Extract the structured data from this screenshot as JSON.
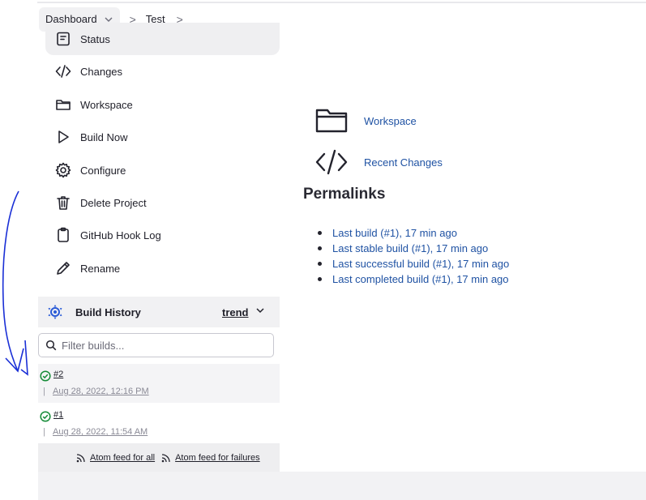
{
  "breadcrumb": {
    "dashboard": "Dashboard",
    "separator": ">",
    "job": "Test"
  },
  "side_tasks": [
    {
      "label": "Status",
      "icon": "status-icon"
    },
    {
      "label": "Changes",
      "icon": "code-icon"
    },
    {
      "label": "Workspace",
      "icon": "folder-icon"
    },
    {
      "label": "Build Now",
      "icon": "play-icon"
    },
    {
      "label": "Configure",
      "icon": "gear-icon"
    },
    {
      "label": "Delete Project",
      "icon": "trash-icon"
    },
    {
      "label": "GitHub Hook Log",
      "icon": "clipboard-icon"
    },
    {
      "label": "Rename",
      "icon": "pencil-icon"
    }
  ],
  "build_history": {
    "title": "Build History",
    "trend": "trend",
    "filter_placeholder": "Filter builds...",
    "builds": [
      {
        "number": "#2",
        "date": "Aug 28, 2022, 12:16 PM",
        "status": "success"
      },
      {
        "number": "#1",
        "date": "Aug 28, 2022, 11:54 AM",
        "status": "success"
      }
    ],
    "feed_all": "Atom feed for all",
    "feed_failures": "Atom feed for failures"
  },
  "main": {
    "workspace_link": "Workspace",
    "recent_changes_link": "Recent Changes",
    "permalinks_title": "Permalinks",
    "permalinks": [
      "Last build (#1), 17 min ago",
      "Last stable build (#1), 17 min ago",
      "Last successful build (#1), 17 min ago",
      "Last completed build (#1), 17 min ago"
    ]
  },
  "colors": {
    "link": "#1f52a3",
    "success": "#138a36",
    "annotation": "#1a2fd6"
  }
}
